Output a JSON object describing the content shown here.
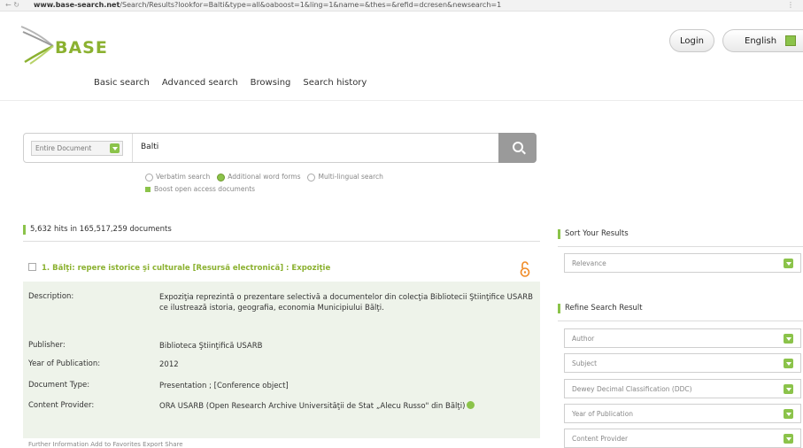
{
  "browser": {
    "nav": "← ↻",
    "url_host": "www.base-search.net",
    "url_path": "/Search/Results?lookfor=Balti&type=all&oaboost=1&ling=1&name=&thes=&refid=dcresen&newsearch=1",
    "menu": "⋮"
  },
  "header": {
    "logo_text": "BASE",
    "login_label": "Login",
    "language_label": "English"
  },
  "nav": {
    "items": [
      "Basic search",
      "Advanced search",
      "Browsing",
      "Search history"
    ]
  },
  "search": {
    "scope_label": "Entire Document",
    "query": "Balti",
    "options": {
      "verbatim": "Verbatim search",
      "additional": "Additional word forms",
      "multilingual": "Multi-lingual search",
      "boost": "Boost open access documents"
    }
  },
  "results": {
    "hits_summary": "5,632 hits in 165,517,259 documents",
    "first": {
      "title": "1. Bălţi: repere istorice şi culturale [Resursă electronică] : Expoziţie",
      "rows": [
        {
          "label": "Description:",
          "value": "Expoziţia reprezintă o prezentare selectivă a documentelor din colecţia Bibliotecii Ştiinţifice USARB ce ilustrează istoria, geografia, economia Municipiului Bălţi."
        },
        {
          "label": "Publisher:",
          "value": "Biblioteca Ştiinţifică USARB"
        },
        {
          "label": "Year of Publication:",
          "value": "2012"
        },
        {
          "label": "Document Type:",
          "value": "Presentation ; [Conference object]"
        },
        {
          "label": "Content Provider:",
          "value": "ORA USARB (Open Research Archive Universităţii de Stat „Alecu Russo\" din Bălţi)"
        }
      ]
    },
    "bottom_hint": "Further Information   Add to Favorites   Export   Share"
  },
  "sidebar": {
    "sort_heading": "Sort Your Results",
    "sort_value": "Relevance",
    "refine_heading": "Refine Search Result",
    "filters": [
      "Author",
      "Subject",
      "Dewey Decimal Classification (DDC)",
      "Year of Publication",
      "Content Provider"
    ]
  },
  "colors": {
    "accent": "#8bc34a",
    "title_green": "#8bb130",
    "detail_bg": "#eef3ea",
    "open_access": "#f08a24"
  }
}
